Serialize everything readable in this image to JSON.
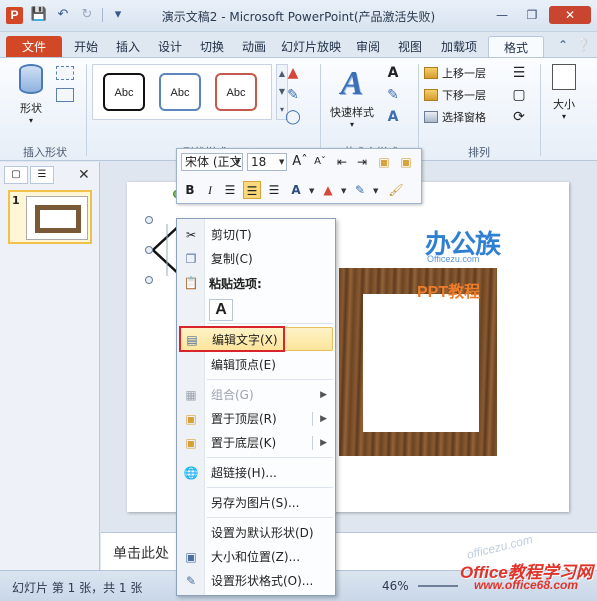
{
  "titlebar": {
    "app_icon": "P",
    "title": "演示文稿2 - Microsoft PowerPoint(产品激活失败)",
    "qat_icons": [
      "save-icon",
      "undo-icon",
      "redo-icon",
      "customize-icon"
    ]
  },
  "tabs": {
    "file": "文件",
    "items": [
      "开始",
      "插入",
      "设计",
      "切换",
      "动画",
      "幻灯片放映",
      "审阅",
      "视图",
      "加载项",
      "格式"
    ],
    "active": "格式"
  },
  "ribbon": {
    "shape_button": "形状",
    "group_insert_shapes": "插入形状",
    "style_gallery": [
      "Abc",
      "Abc",
      "Abc"
    ],
    "group_shape_styles": "形状样式",
    "quick_styles": "快速样式",
    "group_wordart": "艺术字样式",
    "arrange_items": [
      "上移一层",
      "下移一层",
      "选择窗格"
    ],
    "group_arrange": "排列",
    "size_button": "大小"
  },
  "mini_toolbar": {
    "font": "宋体 (正文",
    "size": "18"
  },
  "context_menu": {
    "cut": "剪切(T)",
    "copy": "复制(C)",
    "paste_options": "粘贴选项:",
    "paste_keep_text": "A",
    "edit_text": "编辑文字(X)",
    "edit_points": "编辑顶点(E)",
    "group": "组合(G)",
    "bring_to_front": "置于顶层(R)",
    "send_to_back": "置于底层(K)",
    "hyperlink": "超链接(H)...",
    "save_as_picture": "另存为图片(S)...",
    "set_default_shape": "设置为默认形状(D)",
    "size_position": "大小和位置(Z)...",
    "format_shape": "设置形状格式(O)..."
  },
  "slide": {
    "logo_text": "办公族",
    "logo_sub": "Officezu.com",
    "logo_ppt": "PPT教程"
  },
  "slide_panel": {
    "slide_number": "1"
  },
  "notes": {
    "placeholder": "单击此处"
  },
  "status": {
    "slide_info": "幻灯片 第 1 张，共 1 张",
    "zoom": "46%"
  },
  "watermark": {
    "faint": "officezu.com",
    "main": "Office教程学习网",
    "url": "www.office68.com"
  }
}
